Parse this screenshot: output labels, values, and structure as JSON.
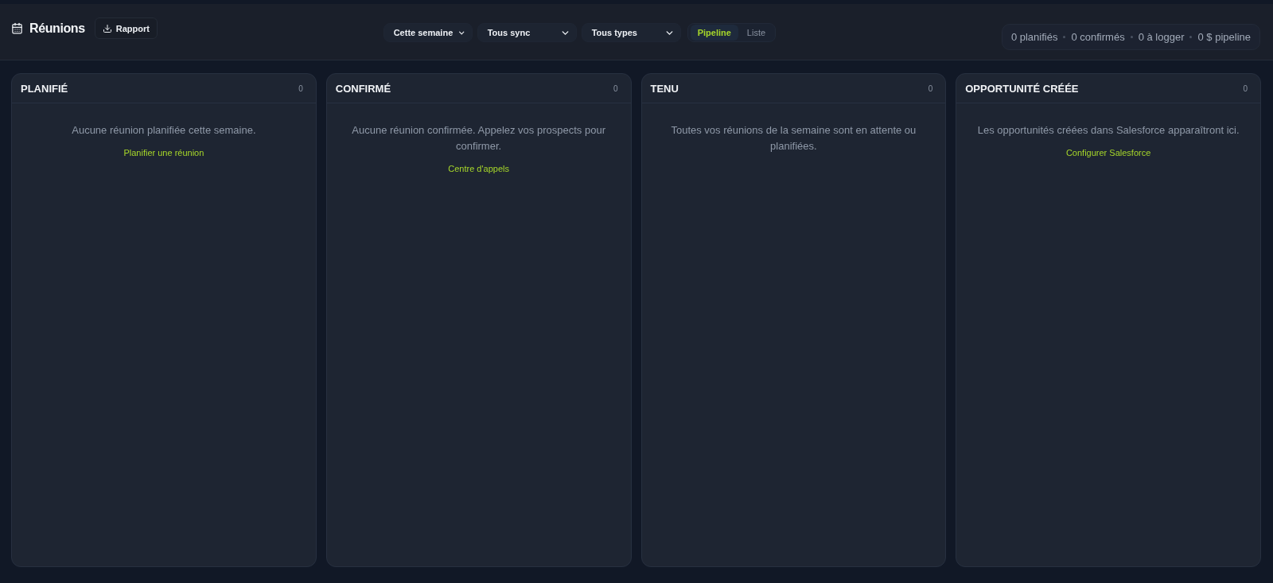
{
  "header": {
    "title": "Réunions",
    "report_button": "Rapport"
  },
  "filters": [
    {
      "kind": "period",
      "value": "Cette semaine"
    },
    {
      "kind": "sync",
      "value": "Tous sync"
    },
    {
      "kind": "type",
      "value": "Tous types"
    }
  ],
  "view_toggle": [
    {
      "label": "Pipeline",
      "selected": true
    },
    {
      "label": "Liste",
      "selected": false
    }
  ],
  "stats": [
    "0 planifiés",
    "0 confirmés",
    "0 à logger",
    "0 $ pipeline"
  ],
  "columns": [
    {
      "title": "PLANIFIÉ",
      "count": "0",
      "message": "Aucune réunion planifiée cette semaine.",
      "action": "Planifier une réunion"
    },
    {
      "title": "CONFIRMÉ",
      "count": "0",
      "message": "Aucune réunion confirmée. Appelez vos prospects pour confirmer.",
      "action": "Centre d'appels"
    },
    {
      "title": "TENU",
      "count": "0",
      "message": "Toutes vos réunions de la semaine sont en attente ou planifiées."
    },
    {
      "title": "OPPORTUNITÉ CRÉÉE",
      "count": "0",
      "message": "Les opportunités créées dans Salesforce apparaîtront ici.",
      "action": "Configurer Salesforce"
    }
  ]
}
